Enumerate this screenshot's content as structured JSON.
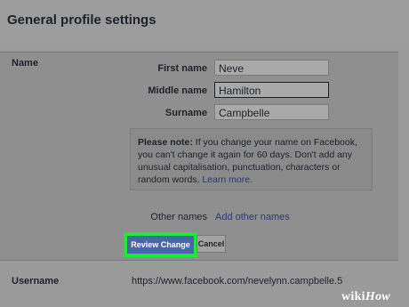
{
  "header": {
    "title": "General profile settings"
  },
  "name_section": {
    "label": "Name",
    "first_name_label": "First name",
    "first_name_value": "Neve",
    "middle_name_label": "Middle name",
    "middle_name_value": "Hamilton",
    "surname_label": "Surname",
    "surname_value": "Campbelle"
  },
  "note": {
    "strong": "Please note:",
    "body": " If you change your name on Facebook, you can't change it again for 60 days. Don't add any unusual capitalisation, punctuation, characters or random words. ",
    "link": "Learn more."
  },
  "other_names": {
    "label": "Other names",
    "link": "Add other names"
  },
  "buttons": {
    "review": "Review Change",
    "cancel": "Cancel"
  },
  "username": {
    "label": "Username",
    "value": "https://www.facebook.com/nevelynn.campbelle.5"
  },
  "watermark": {
    "wiki": "wiki",
    "how": "How"
  },
  "colors": {
    "highlight": "#1ee83a",
    "primary_button": "#4a66a8",
    "link": "#2b3b6b"
  }
}
